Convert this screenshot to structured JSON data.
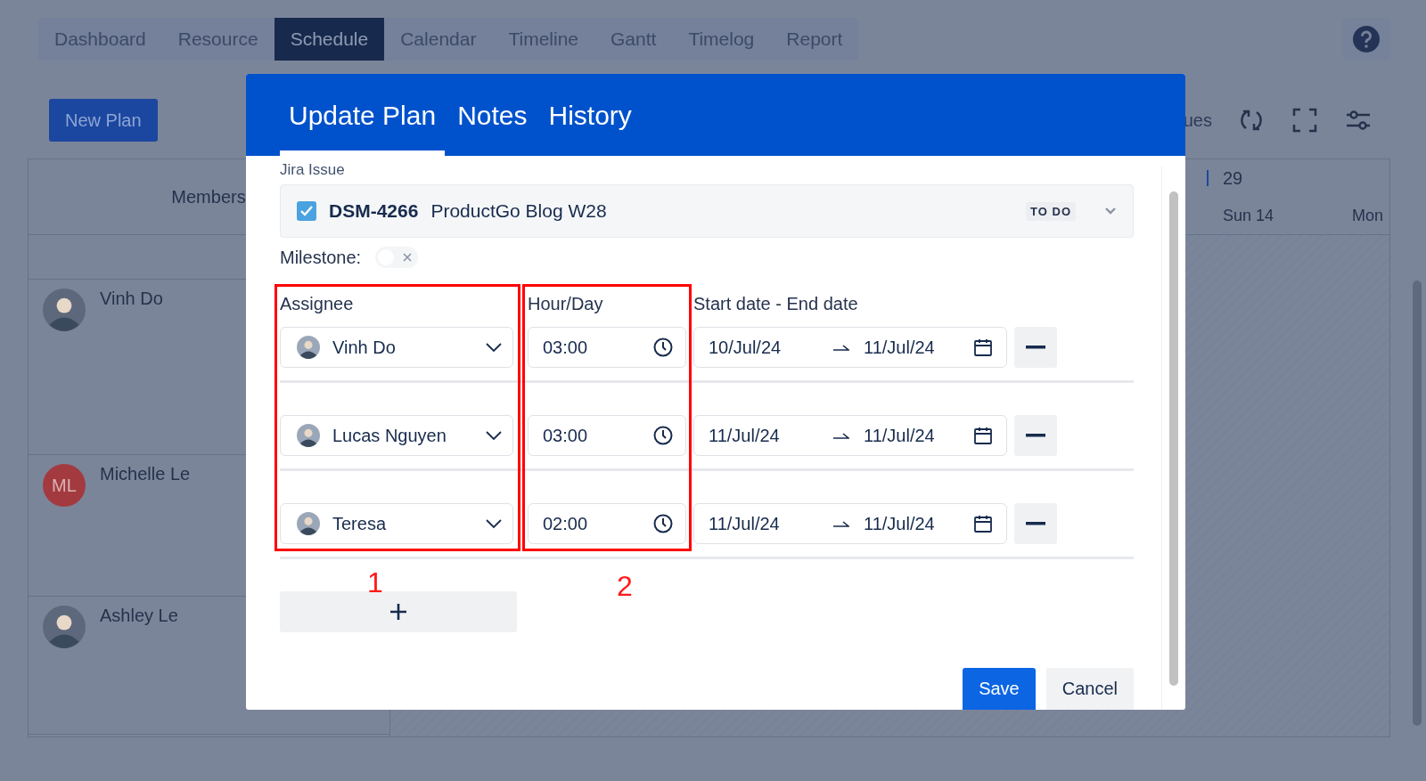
{
  "nav": {
    "tabs": [
      {
        "label": "Dashboard",
        "selected": false
      },
      {
        "label": "Resource",
        "selected": false
      },
      {
        "label": "Schedule",
        "selected": true
      },
      {
        "label": "Calendar",
        "selected": false
      },
      {
        "label": "Timeline",
        "selected": false
      },
      {
        "label": "Gantt",
        "selected": false
      },
      {
        "label": "Timelog",
        "selected": false
      },
      {
        "label": "Report",
        "selected": false
      }
    ]
  },
  "toolbar": {
    "new_plan": "New Plan",
    "issues_partial": "ues"
  },
  "members": {
    "heading": "Members",
    "rows": [
      {
        "name": "Vinh Do",
        "avatar": {
          "kind": "photo"
        }
      },
      {
        "name": "Michelle Le",
        "avatar": {
          "kind": "initials",
          "initials": "ML",
          "color": "#a33a3f"
        }
      },
      {
        "name": "Ashley Le",
        "avatar": {
          "kind": "photo"
        }
      }
    ]
  },
  "calendar": {
    "week": "29",
    "days": [
      "Sun 14",
      "Mon"
    ]
  },
  "dialog": {
    "tabs": [
      {
        "label": "Update Plan",
        "selected": true
      },
      {
        "label": "Notes",
        "selected": false
      },
      {
        "label": "History",
        "selected": false
      }
    ],
    "jira_issue": {
      "label": "Jira Issue",
      "checked": true,
      "key": "DSM-4266",
      "summary": "ProductGo Blog W28",
      "status": "TO DO"
    },
    "milestone": {
      "label": "Milestone:",
      "on": false
    },
    "columns": [
      "Assignee",
      "Hour/Day",
      "Start date - End date"
    ],
    "rows": [
      {
        "assignee": "Vinh Do",
        "hours": "03:00",
        "start": "10/Jul/24",
        "end": "11/Jul/24"
      },
      {
        "assignee": "Lucas Nguyen",
        "hours": "03:00",
        "start": "11/Jul/24",
        "end": "11/Jul/24"
      },
      {
        "assignee": "Teresa",
        "hours": "02:00",
        "start": "11/Jul/24",
        "end": "11/Jul/24"
      }
    ],
    "buttons": [
      {
        "label": "Save",
        "kind": "primary"
      },
      {
        "label": "Cancel",
        "kind": "secondary"
      }
    ]
  },
  "annotations": [
    {
      "label": "1"
    },
    {
      "label": "2"
    }
  ]
}
